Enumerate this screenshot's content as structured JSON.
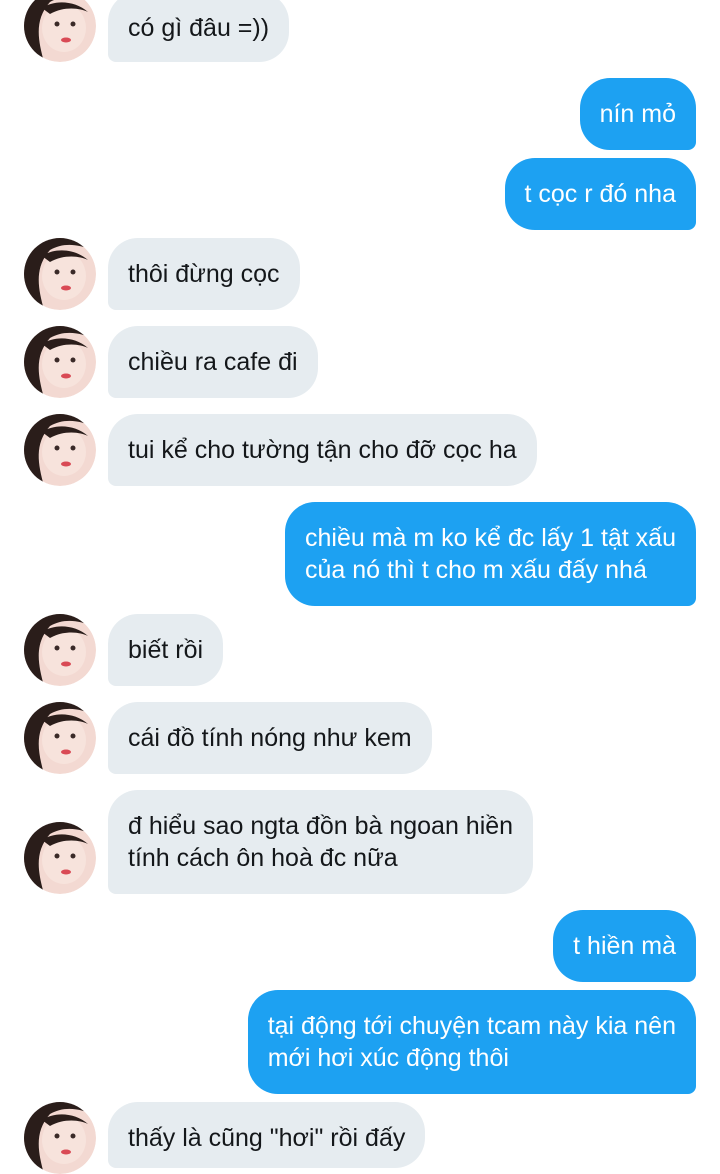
{
  "colors": {
    "incoming_bubble": "#e6ecf0",
    "outgoing_bubble": "#1da1f2",
    "incoming_text": "#14171a",
    "outgoing_text": "#ffffff"
  },
  "avatar_icon": "contact-avatar-photo",
  "messages": [
    {
      "direction": "in",
      "text": "có gì đâu =))"
    },
    {
      "direction": "out",
      "text": "nín mỏ"
    },
    {
      "direction": "out",
      "text": "t cọc r đó nha"
    },
    {
      "direction": "in",
      "text": "thôi đừng cọc"
    },
    {
      "direction": "in",
      "text": "chiều ra cafe đi"
    },
    {
      "direction": "in",
      "text": "tui kể cho tường tận cho đỡ cọc ha"
    },
    {
      "direction": "out",
      "text": "chiều mà m ko kể đc lấy 1 tật xấu\ncủa nó thì t cho m xấu đấy nhá"
    },
    {
      "direction": "in",
      "text": "biết rồi"
    },
    {
      "direction": "in",
      "text": "cái đồ tính nóng như kem"
    },
    {
      "direction": "in",
      "text": "đ hiểu sao ngta đồn bà ngoan hiền\ntính cách ôn hoà đc nữa"
    },
    {
      "direction": "out",
      "text": "t hiền mà"
    },
    {
      "direction": "out",
      "text": "tại động tới chuyện tcam này kia nên\nmới hơi xúc động thôi"
    },
    {
      "direction": "in",
      "text": "thấy là cũng \"hơi\" rồi đấy"
    }
  ]
}
